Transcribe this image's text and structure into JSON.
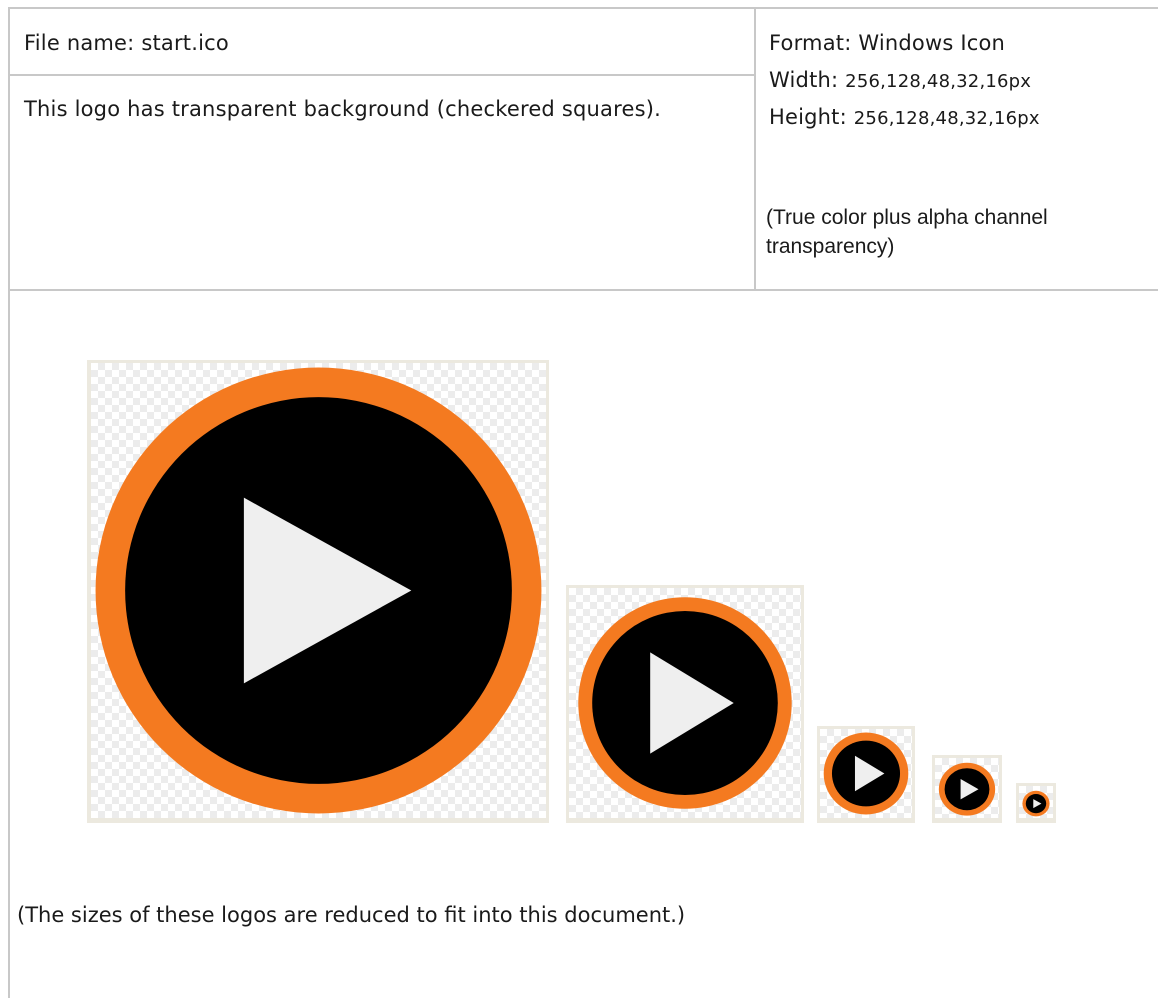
{
  "header": {
    "filename_label": "File name: start.ico",
    "description": "This logo has transparent background (checkered squares).",
    "format_label": "Format: Windows Icon",
    "width_label": "Width: ",
    "width_value": "256,128,48,32,16px",
    "height_label": "Height: ",
    "height_value": "256,128,48,32,16px",
    "color_note": "(True color plus alpha channel transparency)"
  },
  "icons": [
    {
      "size": "256",
      "name": "play-icon-256"
    },
    {
      "size": "128",
      "name": "play-icon-128"
    },
    {
      "size": "48",
      "name": "play-icon-48"
    },
    {
      "size": "32",
      "name": "play-icon-32"
    },
    {
      "size": "16",
      "name": "play-icon-16"
    }
  ],
  "colors": {
    "ring": "#f47a20",
    "disc": "#000000",
    "triangle": "#efefef",
    "frame": "#ece9df",
    "checker": "#ececec",
    "table_line": "#c8c8c8"
  },
  "footnote": "(The sizes of these logos are reduced to fit into this document.)"
}
